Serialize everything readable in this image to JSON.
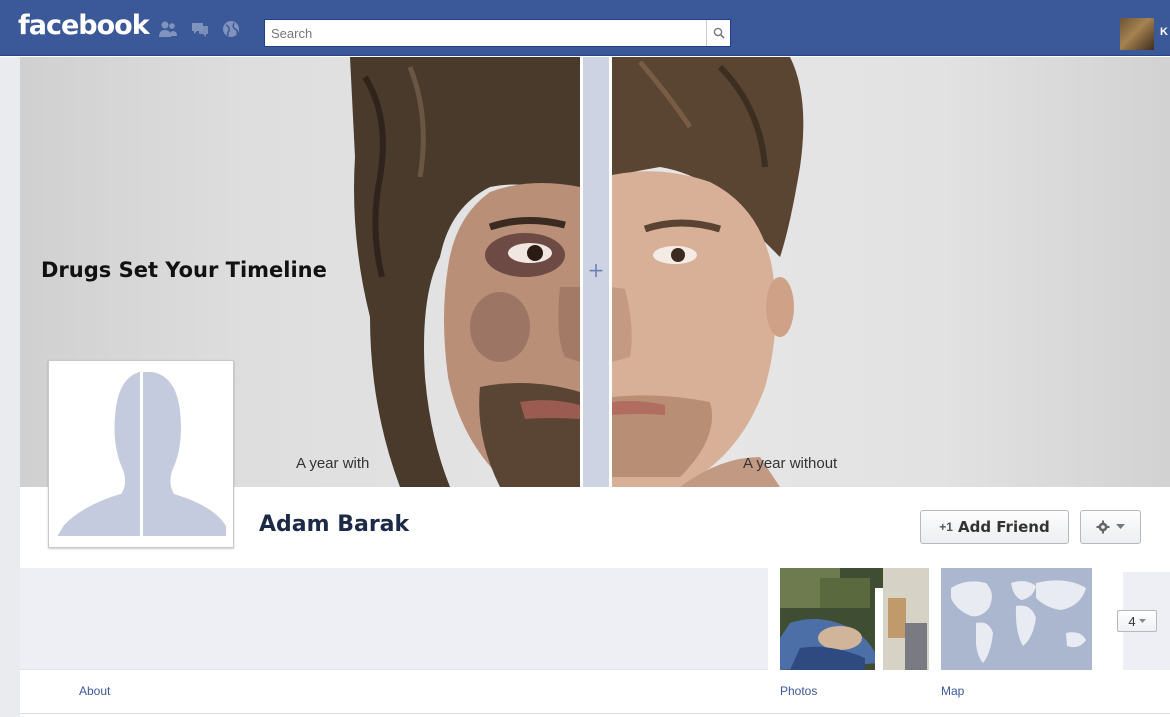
{
  "header": {
    "logo": "facebook",
    "search_placeholder": "Search",
    "user_initial": "K",
    "icons": [
      "friends-icon",
      "messages-icon",
      "notifications-icon",
      "search-icon"
    ]
  },
  "cover": {
    "title": "Drugs Set Your Timeline",
    "caption_with": "A year with",
    "caption_without": "A year without"
  },
  "profile": {
    "name": "Adam Barak",
    "add_friend_label": "Add Friend",
    "add_friend_icon": "+1"
  },
  "sections": {
    "about_label": "About",
    "photos_label": "Photos",
    "map_label": "Map",
    "more_count": "4"
  },
  "colors": {
    "brand": "#3b5998",
    "link": "#3b5998",
    "name": "#1c2a47"
  }
}
